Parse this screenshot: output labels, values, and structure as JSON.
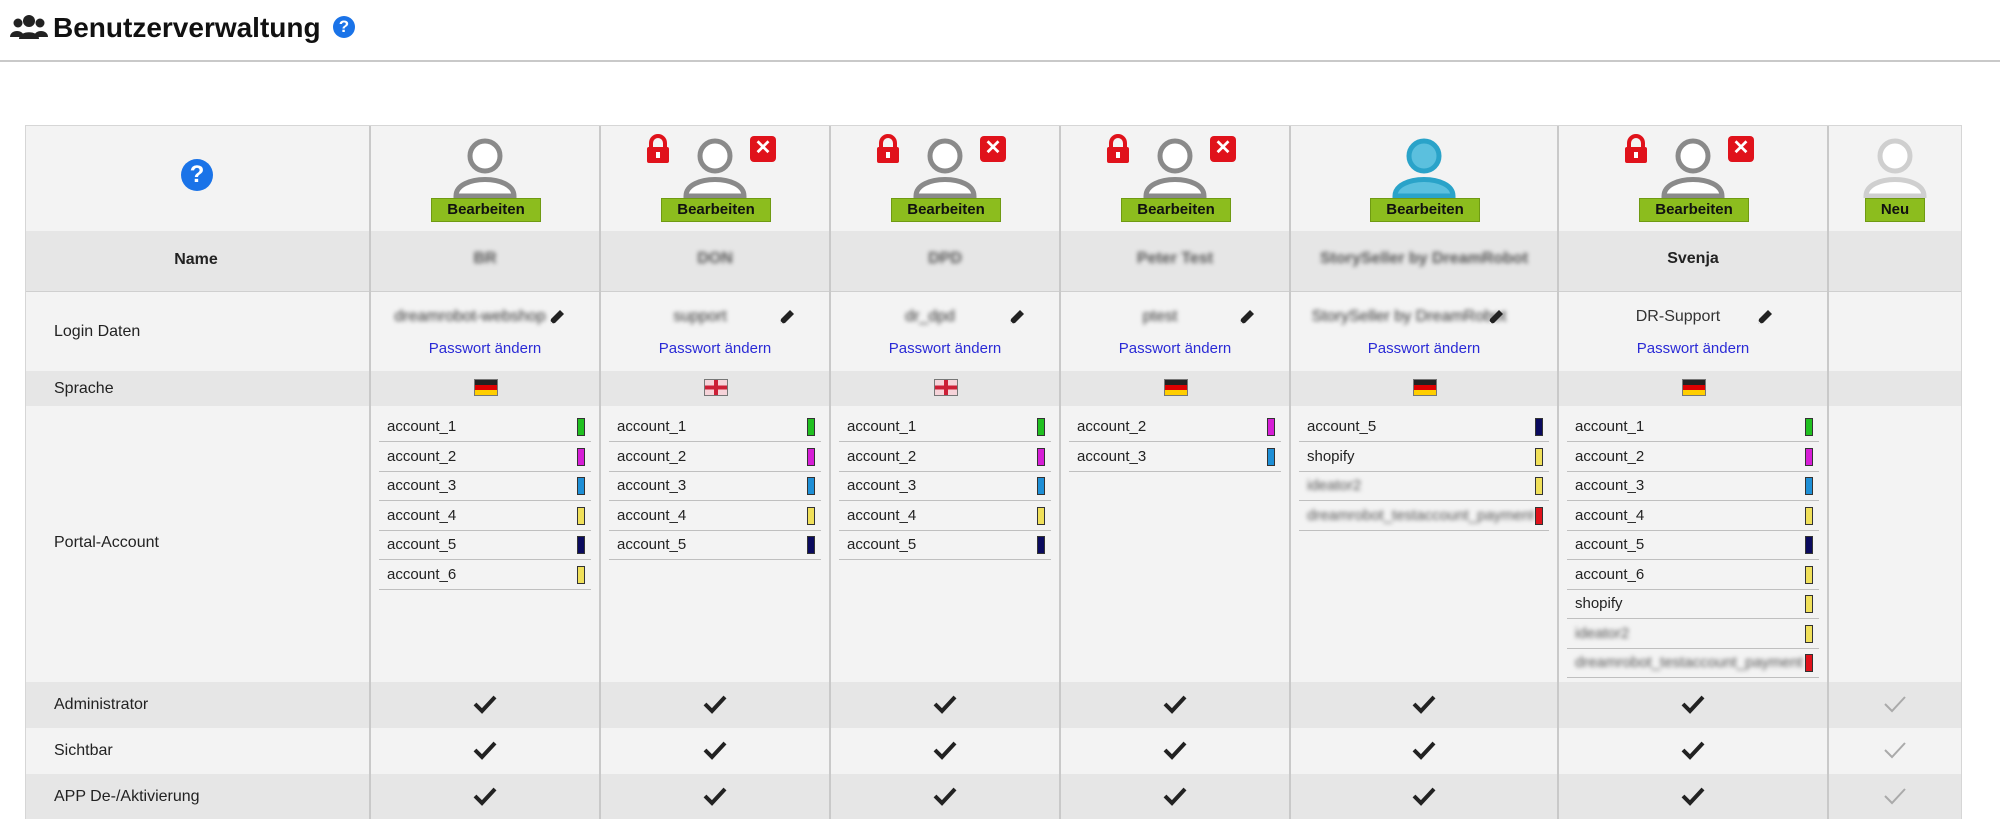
{
  "header": {
    "title": "Benutzerverwaltung",
    "help_glyph": "?"
  },
  "table": {
    "help_glyph": "?",
    "row_labels": {
      "name": "Name",
      "login": "Login Daten",
      "language": "Sprache",
      "portal": "Portal-Account",
      "admin": "Administrator",
      "visible": "Sichtbar",
      "app": "APP De-/Aktivierung"
    },
    "users": [
      {
        "name": "BR",
        "login": "dreamrobot-webshop",
        "lang": "de",
        "locked": false,
        "deletable": false,
        "active_avatar": false,
        "button": "Bearbeiten",
        "password_link": "Passwort ändern",
        "accounts": [
          [
            "account_1",
            "#20c020"
          ],
          [
            "account_2",
            "#d61ed6"
          ],
          [
            "account_3",
            "#1e8fd6"
          ],
          [
            "account_4",
            "#f0e05a"
          ],
          [
            "account_5",
            "#0a0a5e"
          ],
          [
            "account_6",
            "#f0e05a"
          ]
        ],
        "admin": true,
        "visible": true,
        "app": true
      },
      {
        "name": "DON",
        "login": "support",
        "lang": "en",
        "locked": true,
        "deletable": true,
        "active_avatar": false,
        "button": "Bearbeiten",
        "password_link": "Passwort ändern",
        "accounts": [
          [
            "account_1",
            "#20c020"
          ],
          [
            "account_2",
            "#d61ed6"
          ],
          [
            "account_3",
            "#1e8fd6"
          ],
          [
            "account_4",
            "#f0e05a"
          ],
          [
            "account_5",
            "#0a0a5e"
          ]
        ],
        "admin": true,
        "visible": true,
        "app": true
      },
      {
        "name": "DPD",
        "login": "dr_dpd",
        "lang": "en",
        "locked": true,
        "deletable": true,
        "active_avatar": false,
        "button": "Bearbeiten",
        "password_link": "Passwort ändern",
        "accounts": [
          [
            "account_1",
            "#20c020"
          ],
          [
            "account_2",
            "#d61ed6"
          ],
          [
            "account_3",
            "#1e8fd6"
          ],
          [
            "account_4",
            "#f0e05a"
          ],
          [
            "account_5",
            "#0a0a5e"
          ]
        ],
        "admin": true,
        "visible": true,
        "app": true
      },
      {
        "name": "Peter Test",
        "login": "ptest",
        "lang": "de",
        "locked": true,
        "deletable": true,
        "active_avatar": false,
        "button": "Bearbeiten",
        "password_link": "Passwort ändern",
        "accounts": [
          [
            "account_2",
            "#d61ed6"
          ],
          [
            "account_3",
            "#1e8fd6"
          ]
        ],
        "admin": true,
        "visible": true,
        "app": true
      },
      {
        "name": "StorySeller by DreamRobot",
        "login": "StorySeller by DreamRobot",
        "lang": "de",
        "locked": false,
        "deletable": false,
        "active_avatar": true,
        "button": "Bearbeiten",
        "password_link": "Passwort ändern",
        "accounts": [
          [
            "account_5",
            "#0a0a5e"
          ],
          [
            "shopify",
            "#f0e05a"
          ],
          [
            "ideator2",
            "#f0e05a"
          ],
          [
            "dreamrobot_testaccount_payments",
            "#e0121b"
          ]
        ],
        "admin": true,
        "visible": true,
        "app": true
      },
      {
        "name": "Svenja",
        "login": "DR-Support",
        "lang": "de",
        "locked": true,
        "deletable": true,
        "active_avatar": false,
        "button": "Bearbeiten",
        "password_link": "Passwort ändern",
        "accounts": [
          [
            "account_1",
            "#20c020"
          ],
          [
            "account_2",
            "#d61ed6"
          ],
          [
            "account_3",
            "#1e8fd6"
          ],
          [
            "account_4",
            "#f0e05a"
          ],
          [
            "account_5",
            "#0a0a5e"
          ],
          [
            "account_6",
            "#f0e05a"
          ],
          [
            "shopify",
            "#f0e05a"
          ],
          [
            "ideator2",
            "#f0e05a"
          ],
          [
            "dreamrobot_testaccount_payments",
            "#e0121b"
          ]
        ],
        "admin": true,
        "visible": true,
        "app": true
      }
    ],
    "new_user": {
      "button": "Neu"
    }
  }
}
